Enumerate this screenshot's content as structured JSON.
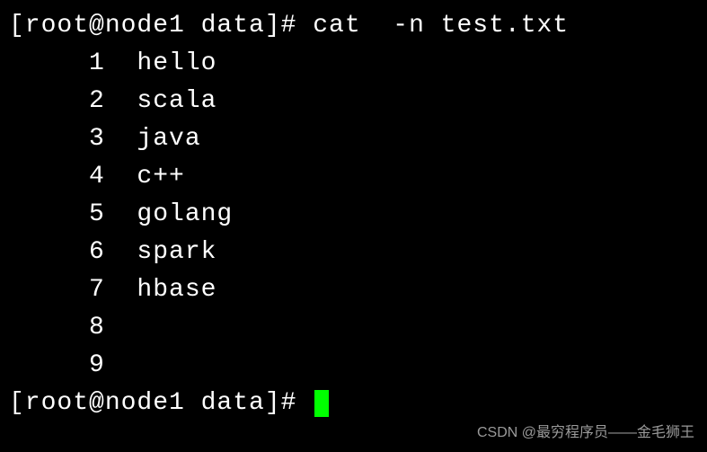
{
  "prompt1": "[root@node1 data]# cat  -n test.txt",
  "output": {
    "lines": [
      "     1  hello",
      "     2  scala",
      "     3  java",
      "     4  c++",
      "     5  golang",
      "     6  spark",
      "     7  hbase",
      "     8",
      "     9"
    ]
  },
  "prompt2": "[root@node1 data]# ",
  "watermark": "CSDN @最穷程序员——金毛狮王"
}
